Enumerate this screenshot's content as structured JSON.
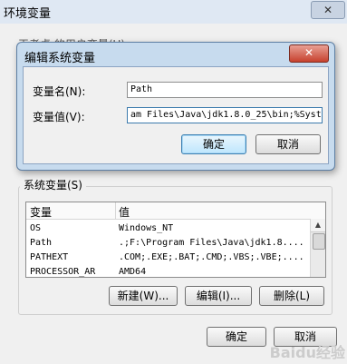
{
  "outer_window": {
    "title": "环境变量",
    "close_glyph": "✕",
    "user_vars_label": "王孝卓 的用户变量(U)"
  },
  "edit_dialog": {
    "title": "编辑系统变量",
    "close_glyph": "✕",
    "var_name_label": "变量名(N):",
    "var_name_value": "Path",
    "var_value_label": "变量值(V):",
    "var_value_value": "am Files\\Java\\jdk1.8.0_25\\bin;%Syst",
    "ok_label": "确定",
    "cancel_label": "取消"
  },
  "system_vars": {
    "group_label": "系统变量(S)",
    "headers": [
      "变量",
      "值"
    ],
    "rows": [
      {
        "name": "OS",
        "value": "Windows_NT"
      },
      {
        "name": "Path",
        "value": ".;F:\\Program Files\\Java\\jdk1.8...."
      },
      {
        "name": "PATHEXT",
        "value": ".COM;.EXE;.BAT;.CMD;.VBS;.VBE;...."
      },
      {
        "name": "PROCESSOR_AR",
        "value": "AMD64"
      }
    ],
    "new_label": "新建(W)...",
    "edit_label": "编辑(I)...",
    "delete_label": "删除(L)"
  },
  "footer": {
    "ok_label": "确定",
    "cancel_label": "取消"
  },
  "watermark": "Baidu经验"
}
